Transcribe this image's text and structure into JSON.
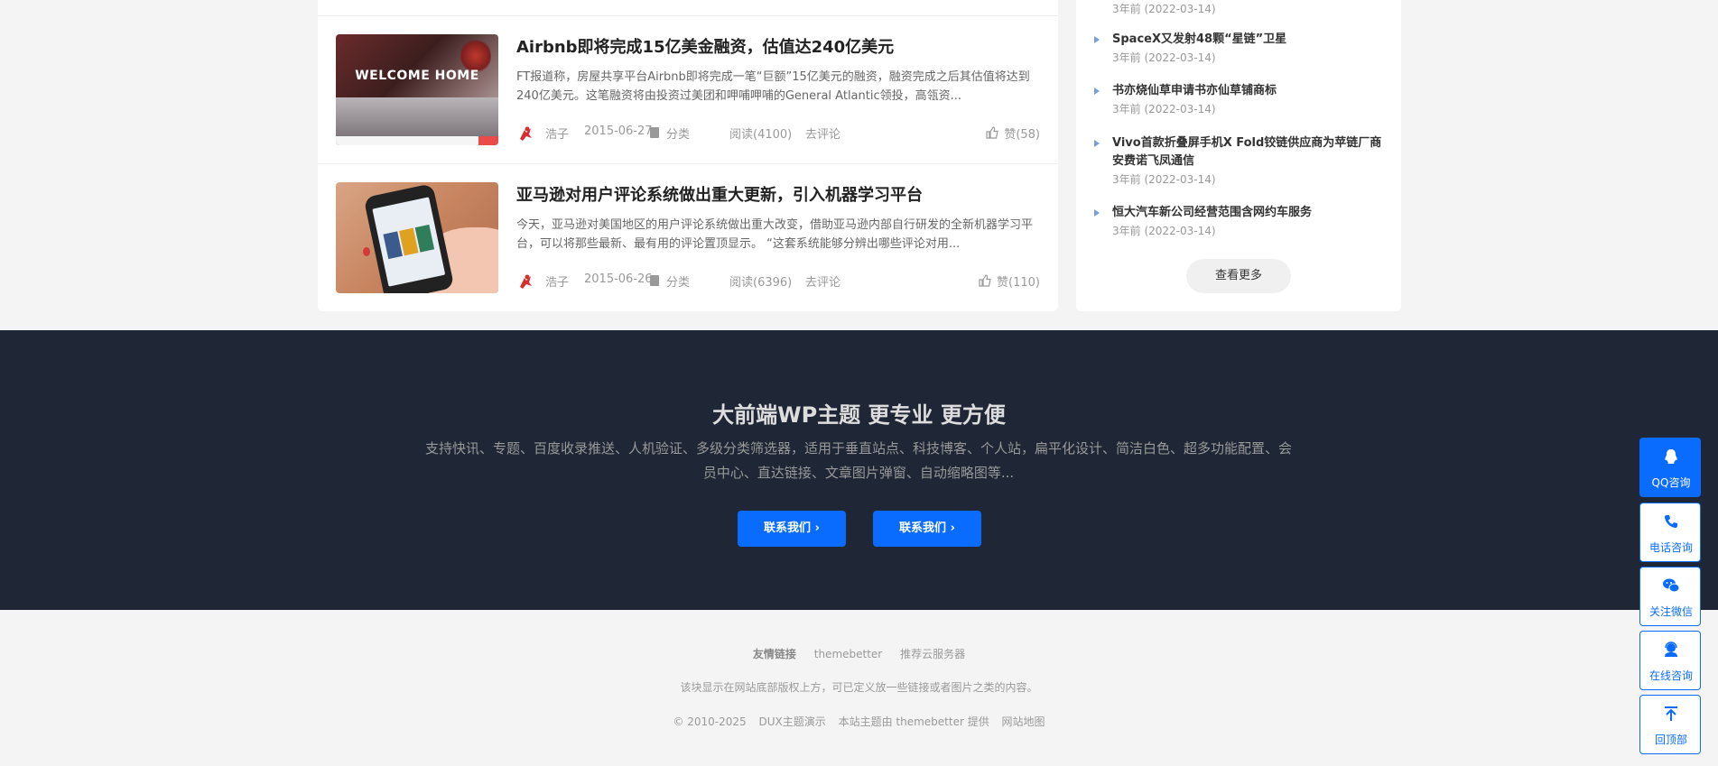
{
  "articles": [
    {
      "title": "Airbnb即将完成15亿美金融资，估值达240亿美元",
      "excerpt": "FT报道称，房屋共享平台Airbnb即将完成一笔“巨额”15亿美元的融资，融资完成之后其估值将达到240亿美元。这笔融资将由投资过美团和呷哺呷哺的General Atlantic领投，高瓴资...",
      "thumb_text": "WELCOME HOME",
      "author": "浩子",
      "date": "2015-06-27",
      "category": "分类",
      "reads": "阅读(4100)",
      "comment": "去评论",
      "likes": "赞(58)"
    },
    {
      "title": "亚马逊对用户评论系统做出重大更新，引入机器学习平台",
      "excerpt": "今天，亚马逊对美国地区的用户评论系统做出重大改变，借助亚马逊内部自行研发的全新机器学习平台，可以将那些最新、最有用的评论置顶显示。 “这套系统能够分辨出哪些评论对用...",
      "author": "浩子",
      "date": "2015-06-26",
      "category": "分类",
      "reads": "阅读(6396)",
      "comment": "去评论",
      "likes": "赞(110)"
    }
  ],
  "sidebar": {
    "top_date": "3年前 (2022-03-14)",
    "items": [
      {
        "title": "SpaceX又发射48颗“星链”卫星",
        "date": "3年前 (2022-03-14)"
      },
      {
        "title": "书亦烧仙草申请书亦仙草铺商标",
        "date": "3年前 (2022-03-14)"
      },
      {
        "title": "Vivo首款折叠屏手机X Fold铰链供应商为苹链厂商安费诺飞凤通信",
        "date": "3年前 (2022-03-14)"
      },
      {
        "title": "恒大汽车新公司经营范围含网约车服务",
        "date": "3年前 (2022-03-14)"
      }
    ],
    "more_label": "查看更多"
  },
  "banner": {
    "title": "大前端WP主题 更专业 更方便",
    "desc": "支持快讯、专题、百度收录推送、人机验证、多级分类筛选器，适用于垂直站点、科技博客、个人站，扁平化设计、简洁白色、超多功能配置、会员中心、直达链接、文章图片弹窗、自动缩略图等...",
    "btn1": "联系我们",
    "btn2": "联系我们"
  },
  "footer": {
    "links_label": "友情链接",
    "links": [
      "themebetter",
      "推荐云服务器"
    ],
    "note": "该块显示在网站底部版权上方，可已定义放一些链接或者图片之类的内容。",
    "copy": "© 2010-2025",
    "site": "DUX主题演示",
    "provider": "本站主题由 themebetter 提供",
    "sitemap": "网站地图"
  },
  "tools": [
    {
      "label": "QQ咨询",
      "icon": "qq-icon"
    },
    {
      "label": "电话咨询",
      "icon": "phone-icon"
    },
    {
      "label": "关注微信",
      "icon": "wechat-icon"
    },
    {
      "label": "在线咨询",
      "icon": "support-icon"
    },
    {
      "label": "回顶部",
      "icon": "back-to-top-icon"
    }
  ],
  "colors": {
    "accent": "#0a6cff",
    "banner_bg": "#1f2635"
  }
}
